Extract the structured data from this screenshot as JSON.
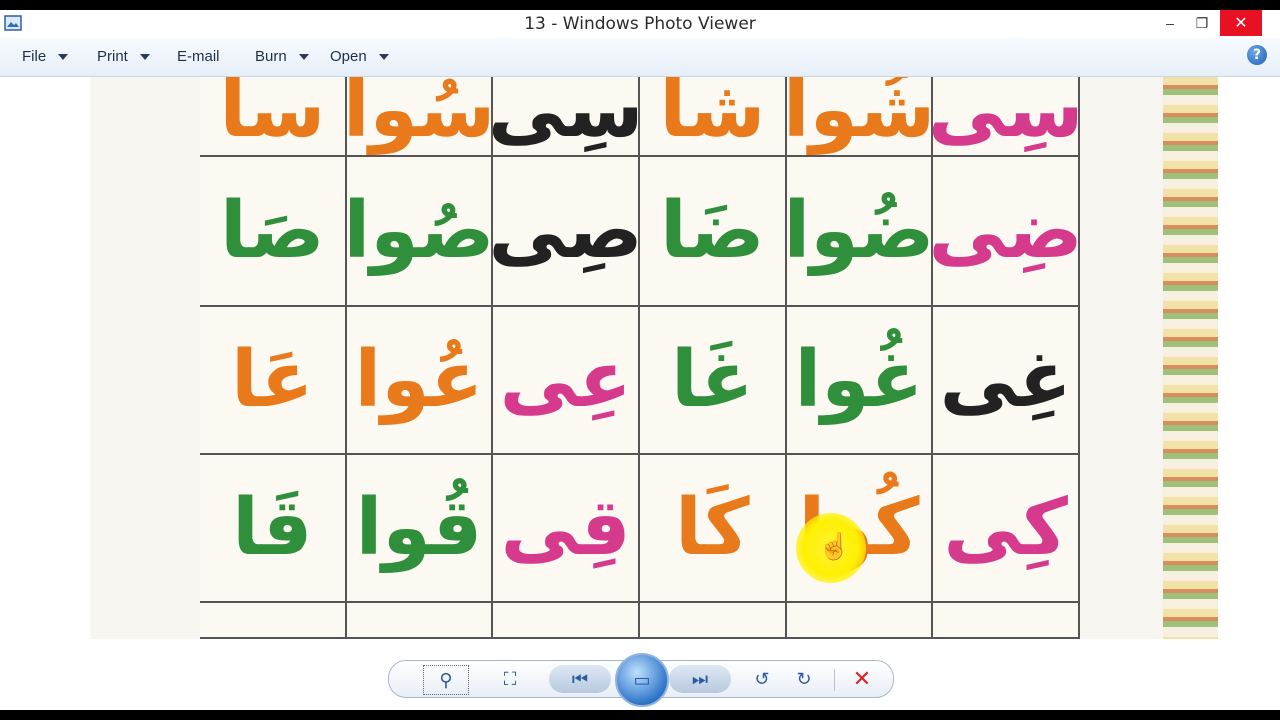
{
  "window": {
    "title": "13 - Windows Photo Viewer",
    "controls": {
      "minimize": "–",
      "maximize": "❐",
      "close": "✕"
    }
  },
  "menu": {
    "items": [
      {
        "label": "File",
        "has_dropdown": true
      },
      {
        "label": "Print",
        "has_dropdown": true
      },
      {
        "label": "E-mail",
        "has_dropdown": false
      },
      {
        "label": "Burn",
        "has_dropdown": true
      },
      {
        "label": "Open",
        "has_dropdown": true
      }
    ],
    "help": "?"
  },
  "photo": {
    "rows": [
      [
        {
          "text": "سِی",
          "color": "#d63a8c"
        },
        {
          "text": "شُوا",
          "color": "#e87a1c"
        },
        {
          "text": "شا",
          "color": "#e87a1c"
        },
        {
          "text": "سِی",
          "color": "#222222"
        },
        {
          "text": "سُوا",
          "color": "#e87a1c"
        },
        {
          "text": "سا",
          "color": "#e87a1c"
        }
      ],
      [
        {
          "text": "ضِی",
          "color": "#d63a8c"
        },
        {
          "text": "ضُوا",
          "color": "#2f8f3a"
        },
        {
          "text": "ضَا",
          "color": "#2f8f3a"
        },
        {
          "text": "صِی",
          "color": "#222222"
        },
        {
          "text": "صُوا",
          "color": "#2f8f3a"
        },
        {
          "text": "صَا",
          "color": "#2f8f3a"
        }
      ],
      [
        {
          "text": "غِی",
          "color": "#222222"
        },
        {
          "text": "غُوا",
          "color": "#2f8f3a"
        },
        {
          "text": "غَا",
          "color": "#2f8f3a"
        },
        {
          "text": "عِی",
          "color": "#d63a8c"
        },
        {
          "text": "عُوا",
          "color": "#e87a1c"
        },
        {
          "text": "عَا",
          "color": "#e87a1c"
        }
      ],
      [
        {
          "text": "کِی",
          "color": "#d63a8c"
        },
        {
          "text": "کُوا",
          "color": "#e87a1c"
        },
        {
          "text": "کَا",
          "color": "#e87a1c"
        },
        {
          "text": "قِی",
          "color": "#d63a8c"
        },
        {
          "text": "قُوا",
          "color": "#2f8f3a"
        },
        {
          "text": "قَا",
          "color": "#2f8f3a"
        }
      ]
    ]
  },
  "bottom_controls": {
    "zoom": "⚲",
    "actual_size": "⛶",
    "previous": "⏮",
    "slideshow": "▭",
    "next": "⏭",
    "rotate_left": "↺",
    "rotate_right": "↻",
    "delete": "✕"
  }
}
